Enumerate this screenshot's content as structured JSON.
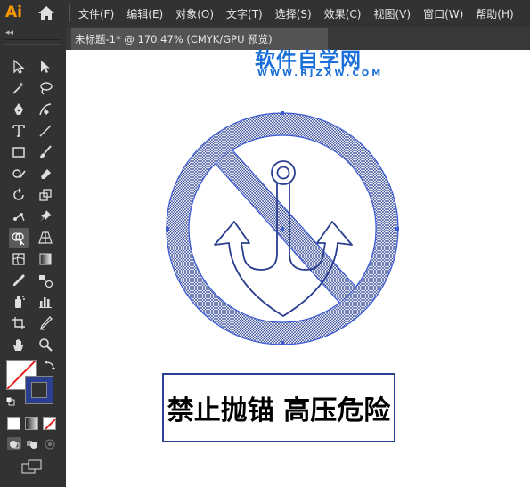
{
  "app": {
    "logo": "Ai",
    "menu": [
      "文件(F)",
      "编辑(E)",
      "对象(O)",
      "文字(T)",
      "选择(S)",
      "效果(C)",
      "视图(V)",
      "窗口(W)",
      "帮助(H)"
    ]
  },
  "toolbar": {
    "collapse_label": "◂◂"
  },
  "document": {
    "tab_title": "未标题-1* @ 170.47% (CMYK/GPU 预览)"
  },
  "watermark": {
    "title": "软件自学网",
    "subtitle": "WWW.RJZXW.COM"
  },
  "artwork": {
    "banner_text": "禁止抛锚 高压危险",
    "stroke_color": "#2a3f8f",
    "selection_color": "#3b5bd6"
  },
  "colors": {
    "menubar_bg": "#323232",
    "canvas_bg": "#ffffff",
    "logo": "#ff9a00",
    "watermark": "#1a6fd8"
  }
}
